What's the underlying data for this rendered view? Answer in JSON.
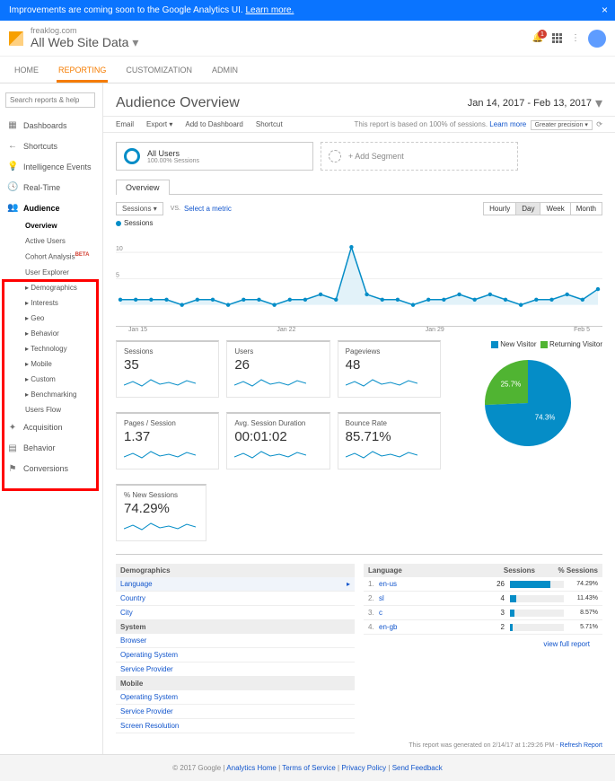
{
  "banner": {
    "text": "Improvements are coming soon to the Google Analytics UI.",
    "learn": "Learn more."
  },
  "header": {
    "account": "freaklog.com",
    "view": "All Web Site Data",
    "bell_count": "1"
  },
  "nav": [
    "HOME",
    "REPORTING",
    "CUSTOMIZATION",
    "ADMIN"
  ],
  "search_placeholder": "Search reports & help",
  "sidebar": {
    "dashboards": "Dashboards",
    "shortcuts": "Shortcuts",
    "intel": "Intelligence Events",
    "realtime": "Real-Time",
    "audience": "Audience",
    "acquisition": "Acquisition",
    "behavior": "Behavior",
    "conversions": "Conversions",
    "subs": [
      "Overview",
      "Active Users",
      "Cohort Analysis",
      "User Explorer",
      "Demographics",
      "Interests",
      "Geo",
      "Behavior",
      "Technology",
      "Mobile",
      "Custom",
      "Benchmarking",
      "Users Flow"
    ]
  },
  "page": {
    "title": "Audience Overview",
    "date": "Jan 14, 2017 - Feb 13, 2017"
  },
  "toolbar": {
    "email": "Email",
    "export": "Export",
    "add": "Add to Dashboard",
    "shortcut": "Shortcut",
    "sample": "This report is based on 100% of sessions.",
    "learn": "Learn more",
    "precision": "Greater precision"
  },
  "seg": {
    "all": "All Users",
    "allsub": "100.00% Sessions",
    "add": "+ Add Segment"
  },
  "ov_tab": "Overview",
  "controls": {
    "sessions": "Sessions",
    "vs": "VS.",
    "select": "Select a metric",
    "hourly": "Hourly",
    "day": "Day",
    "week": "Week",
    "month": "Month"
  },
  "chart_legend": "Sessions",
  "chart_data": {
    "type": "line",
    "metric": "Sessions",
    "ylim": [
      0,
      12
    ],
    "yticks": [
      5,
      10
    ],
    "x_ticks": [
      "Jan 15",
      "Jan 22",
      "Jan 29",
      "Feb 5"
    ],
    "values": [
      1,
      1,
      1,
      1,
      0,
      1,
      1,
      0,
      1,
      1,
      0,
      1,
      1,
      2,
      1,
      11,
      2,
      1,
      1,
      0,
      1,
      1,
      2,
      1,
      2,
      1,
      0,
      1,
      1,
      2,
      1,
      3
    ]
  },
  "metrics": [
    {
      "lbl": "Sessions",
      "val": "35"
    },
    {
      "lbl": "Users",
      "val": "26"
    },
    {
      "lbl": "Pageviews",
      "val": "48"
    },
    {
      "lbl": "Pages / Session",
      "val": "1.37"
    },
    {
      "lbl": "Avg. Session Duration",
      "val": "00:01:02"
    },
    {
      "lbl": "Bounce Rate",
      "val": "85.71%"
    },
    {
      "lbl": "% New Sessions",
      "val": "74.29%"
    }
  ],
  "pie": {
    "new_label": "New Visitor",
    "ret_label": "Returning Visitor",
    "new": 74.3,
    "ret": 25.7,
    "new_pct": "74.3%",
    "ret_pct": "25.7%",
    "colors": {
      "new": "#058dc7",
      "ret": "#50b432"
    }
  },
  "left_table": {
    "demo_hdr": "Demographics",
    "demo": [
      "Language",
      "Country",
      "City"
    ],
    "sys_hdr": "System",
    "sys": [
      "Browser",
      "Operating System",
      "Service Provider"
    ],
    "mob_hdr": "Mobile",
    "mob": [
      "Operating System",
      "Service Provider",
      "Screen Resolution"
    ]
  },
  "lang_table": {
    "hdr": {
      "lang": "Language",
      "sess": "Sessions",
      "pct": "% Sessions"
    },
    "rows": [
      {
        "n": "1.",
        "name": "en-us",
        "v": "26",
        "pct": "74.29%",
        "w": 74.29
      },
      {
        "n": "2.",
        "name": "sl",
        "v": "4",
        "pct": "11.43%",
        "w": 11.43
      },
      {
        "n": "3.",
        "name": "c",
        "v": "3",
        "pct": "8.57%",
        "w": 8.57
      },
      {
        "n": "4.",
        "name": "en-gb",
        "v": "2",
        "pct": "5.71%",
        "w": 5.71
      }
    ],
    "full": "view full report"
  },
  "report_foot": {
    "text": "This report was generated on 2/14/17 at 1:29:26 PM",
    "refresh": "Refresh Report"
  },
  "footer": {
    "copy": "© 2017 Google",
    "links": [
      "Analytics Home",
      "Terms of Service",
      "Privacy Policy",
      "Send Feedback"
    ]
  }
}
